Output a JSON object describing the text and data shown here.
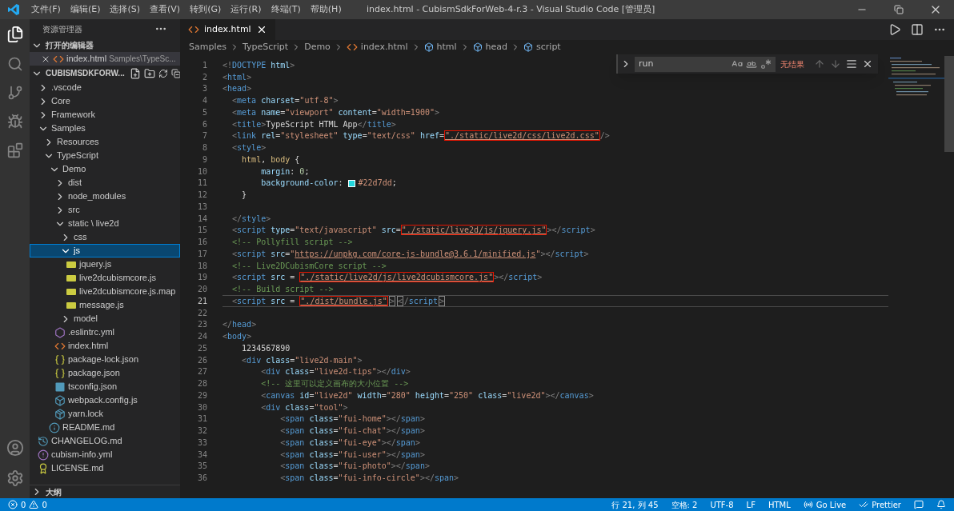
{
  "window": {
    "title": "index.html - CubismSdkForWeb-4-r.3 - Visual Studio Code [管理员]"
  },
  "menu": [
    "文件(F)",
    "编辑(E)",
    "选择(S)",
    "查看(V)",
    "转到(G)",
    "运行(R)",
    "终端(T)",
    "帮助(H)"
  ],
  "sidebar": {
    "title": "资源管理器",
    "open_editors": {
      "title": "打开的编辑器",
      "expanded": true,
      "items": [
        {
          "name": "index.html",
          "path": "Samples\\TypeSc...",
          "kind": "html"
        }
      ]
    },
    "workspace": {
      "title": "CUBISMSDKFORW...",
      "expanded": true,
      "items": [
        {
          "name": ".vscode",
          "kind": "folder",
          "expanded": false,
          "selected": false
        },
        {
          "name": "Core",
          "kind": "folder",
          "expanded": false,
          "selected": false
        },
        {
          "name": "Framework",
          "kind": "folder",
          "expanded": false,
          "selected": false
        },
        {
          "name": "Samples",
          "kind": "folder",
          "expanded": true,
          "selected": false,
          "children": [
            {
              "name": "Resources",
              "kind": "folder",
              "expanded": false,
              "selected": false
            },
            {
              "name": "TypeScript",
              "kind": "folder",
              "expanded": true,
              "selected": false,
              "children": [
                {
                  "name": "Demo",
                  "kind": "folder",
                  "expanded": true,
                  "selected": false,
                  "children": [
                    {
                      "name": "dist",
                      "kind": "folder",
                      "expanded": false,
                      "selected": false
                    },
                    {
                      "name": "node_modules",
                      "kind": "folder",
                      "expanded": false,
                      "selected": false
                    },
                    {
                      "name": "src",
                      "kind": "folder",
                      "expanded": false,
                      "selected": false
                    },
                    {
                      "name": "static \\ live2d",
                      "kind": "folder",
                      "expanded": true,
                      "selected": false,
                      "children": [
                        {
                          "name": "css",
                          "kind": "folder",
                          "expanded": false,
                          "selected": false
                        },
                        {
                          "name": "js",
                          "kind": "folder",
                          "expanded": true,
                          "selected": true,
                          "children": [
                            {
                              "name": "jquery.js",
                              "kind": "js",
                              "selected": false
                            },
                            {
                              "name": "live2dcubismcore.js",
                              "kind": "js",
                              "selected": false
                            },
                            {
                              "name": "live2dcubismcore.js.map",
                              "kind": "js",
                              "selected": false
                            },
                            {
                              "name": "message.js",
                              "kind": "js",
                              "selected": false
                            }
                          ]
                        },
                        {
                          "name": "model",
                          "kind": "folder",
                          "expanded": false,
                          "selected": false
                        }
                      ]
                    },
                    {
                      "name": ".eslintrc.yml",
                      "kind": "eslint",
                      "selected": false
                    },
                    {
                      "name": "index.html",
                      "kind": "html",
                      "selected": false
                    },
                    {
                      "name": "package-lock.json",
                      "kind": "json",
                      "selected": false
                    },
                    {
                      "name": "package.json",
                      "kind": "json",
                      "selected": false
                    },
                    {
                      "name": "tsconfig.json",
                      "kind": "ts",
                      "selected": false
                    },
                    {
                      "name": "webpack.config.js",
                      "kind": "webpack",
                      "selected": false
                    },
                    {
                      "name": "yarn.lock",
                      "kind": "yarn",
                      "selected": false
                    }
                  ]
                },
                {
                  "name": "README.md",
                  "kind": "info",
                  "selected": false
                }
              ]
            }
          ]
        },
        {
          "name": "CHANGELOG.md",
          "kind": "changelog",
          "selected": false
        },
        {
          "name": "cubism-info.yml",
          "kind": "yml",
          "selected": false
        },
        {
          "name": "LICENSE.md",
          "kind": "license",
          "selected": false
        }
      ]
    },
    "outline": {
      "title": "大纲",
      "expanded": false
    }
  },
  "tabs": [
    {
      "label": "index.html",
      "selected": true
    }
  ],
  "breadcrumbs": [
    {
      "label": "Samples",
      "kind": "folder"
    },
    {
      "label": "TypeScript",
      "kind": "folder"
    },
    {
      "label": "Demo",
      "kind": "folder"
    },
    {
      "label": "index.html",
      "kind": "html"
    },
    {
      "label": "html",
      "kind": "element"
    },
    {
      "label": "head",
      "kind": "element"
    },
    {
      "label": "script",
      "kind": "element"
    }
  ],
  "find": {
    "value": "run",
    "result": "无结果"
  },
  "code": [
    {
      "number": "1",
      "current": false,
      "tokens": [
        {
          "kind": "punct",
          "text": "<!"
        },
        {
          "kind": "tag",
          "text": "DOCTYPE"
        },
        {
          "kind": "attr",
          "text": " html"
        },
        {
          "kind": "punct",
          "text": ">"
        }
      ]
    },
    {
      "number": "2",
      "current": false,
      "tokens": [
        {
          "kind": "punct",
          "text": "<"
        },
        {
          "kind": "tag",
          "text": "html"
        },
        {
          "kind": "punct",
          "text": ">"
        }
      ]
    },
    {
      "number": "3",
      "current": false,
      "tokens": [
        {
          "kind": "punct",
          "text": "<"
        },
        {
          "kind": "tag",
          "text": "head"
        },
        {
          "kind": "punct",
          "text": ">"
        }
      ]
    },
    {
      "number": "4",
      "current": false,
      "tokens": [
        {
          "kind": "punct",
          "text": "  <"
        },
        {
          "kind": "tag",
          "text": "meta"
        },
        {
          "kind": "attr",
          "text": " charset"
        },
        {
          "kind": "text",
          "text": "="
        },
        {
          "kind": "str",
          "text": "\"utf-8\""
        },
        {
          "kind": "punct",
          "text": ">"
        }
      ]
    },
    {
      "number": "5",
      "current": false,
      "tokens": [
        {
          "kind": "punct",
          "text": "  <"
        },
        {
          "kind": "tag",
          "text": "meta"
        },
        {
          "kind": "attr",
          "text": " name"
        },
        {
          "kind": "text",
          "text": "="
        },
        {
          "kind": "str",
          "text": "\"viewport\""
        },
        {
          "kind": "attr",
          "text": " content"
        },
        {
          "kind": "text",
          "text": "="
        },
        {
          "kind": "str",
          "text": "\"width=1900\""
        },
        {
          "kind": "punct",
          "text": ">"
        }
      ]
    },
    {
      "number": "6",
      "current": false,
      "tokens": [
        {
          "kind": "punct",
          "text": "  <"
        },
        {
          "kind": "tag",
          "text": "title"
        },
        {
          "kind": "punct",
          "text": ">"
        },
        {
          "kind": "text",
          "text": "TypeScript HTML App"
        },
        {
          "kind": "punct",
          "text": "</"
        },
        {
          "kind": "tag",
          "text": "title"
        },
        {
          "kind": "punct",
          "text": ">"
        }
      ]
    },
    {
      "number": "7",
      "current": false,
      "tokens": [
        {
          "kind": "punct",
          "text": "  <"
        },
        {
          "kind": "tag",
          "text": "link"
        },
        {
          "kind": "attr",
          "text": " rel"
        },
        {
          "kind": "text",
          "text": "="
        },
        {
          "kind": "str",
          "text": "\"stylesheet\""
        },
        {
          "kind": "attr",
          "text": " type"
        },
        {
          "kind": "text",
          "text": "="
        },
        {
          "kind": "str",
          "text": "\"text/css\""
        },
        {
          "kind": "attr",
          "text": " href"
        },
        {
          "kind": "text",
          "text": "="
        },
        {
          "kind": "boxed",
          "text": "\"./static/live2d/css/live2d.css\""
        },
        {
          "kind": "punct",
          "text": "/>"
        }
      ]
    },
    {
      "number": "8",
      "current": false,
      "tokens": [
        {
          "kind": "punct",
          "text": "  <"
        },
        {
          "kind": "tag",
          "text": "style"
        },
        {
          "kind": "punct",
          "text": ">"
        }
      ]
    },
    {
      "number": "9",
      "current": false,
      "tokens": [
        {
          "kind": "selector",
          "text": "    html"
        },
        {
          "kind": "text",
          "text": ", "
        },
        {
          "kind": "selector",
          "text": "body"
        },
        {
          "kind": "text",
          "text": " {"
        }
      ]
    },
    {
      "number": "10",
      "current": false,
      "tokens": [
        {
          "kind": "prop",
          "text": "        margin"
        },
        {
          "kind": "text",
          "text": ": "
        },
        {
          "kind": "num",
          "text": "0"
        },
        {
          "kind": "text",
          "text": ";"
        }
      ]
    },
    {
      "number": "11",
      "current": false,
      "tokens": [
        {
          "kind": "prop",
          "text": "        background-color"
        },
        {
          "kind": "text",
          "text": ": "
        },
        {
          "kind": "swatch",
          "color": "#22d7dd"
        },
        {
          "kind": "str",
          "text": "#22d7dd"
        },
        {
          "kind": "text",
          "text": ";"
        }
      ]
    },
    {
      "number": "12",
      "current": false,
      "tokens": [
        {
          "kind": "text",
          "text": "    }"
        }
      ]
    },
    {
      "number": "13",
      "current": false
    },
    {
      "number": "14",
      "current": false,
      "tokens": [
        {
          "kind": "punct",
          "text": "  </"
        },
        {
          "kind": "tag",
          "text": "style"
        },
        {
          "kind": "punct",
          "text": ">"
        }
      ]
    },
    {
      "number": "15",
      "current": false,
      "tokens": [
        {
          "kind": "punct",
          "text": "  <"
        },
        {
          "kind": "tag",
          "text": "script"
        },
        {
          "kind": "attr",
          "text": " type"
        },
        {
          "kind": "text",
          "text": "="
        },
        {
          "kind": "str",
          "text": "\"text/javascript\""
        },
        {
          "kind": "attr",
          "text": " src"
        },
        {
          "kind": "text",
          "text": "="
        },
        {
          "kind": "boxed",
          "text": "\"./static/live2d/js/jquery.js\""
        },
        {
          "kind": "punct",
          "text": "></"
        },
        {
          "kind": "tag",
          "text": "script"
        },
        {
          "kind": "punct",
          "text": ">"
        }
      ]
    },
    {
      "number": "16",
      "current": false,
      "tokens": [
        {
          "kind": "comment",
          "text": "  <!-- Pollyfill script -->"
        }
      ]
    },
    {
      "number": "17",
      "current": false,
      "tokens": [
        {
          "kind": "punct",
          "text": "  <"
        },
        {
          "kind": "tag",
          "text": "script"
        },
        {
          "kind": "attr",
          "text": " src"
        },
        {
          "kind": "text",
          "text": "="
        },
        {
          "kind": "str",
          "text": "\""
        },
        {
          "kind": "link",
          "text": "https://unpkg.com/core-js-bundle@3.6.1/minified.js"
        },
        {
          "kind": "str",
          "text": "\""
        },
        {
          "kind": "punct",
          "text": "></"
        },
        {
          "kind": "tag",
          "text": "script"
        },
        {
          "kind": "punct",
          "text": ">"
        }
      ]
    },
    {
      "number": "18",
      "current": false,
      "tokens": [
        {
          "kind": "comment",
          "text": "  <!-- Live2DCubismCore script -->"
        }
      ]
    },
    {
      "number": "19",
      "current": false,
      "tokens": [
        {
          "kind": "punct",
          "text": "  <"
        },
        {
          "kind": "tag",
          "text": "script"
        },
        {
          "kind": "attr",
          "text": " src"
        },
        {
          "kind": "text",
          "text": " = "
        },
        {
          "kind": "boxed",
          "text": "\"./static/live2d/js/live2dcubismcore.js\""
        },
        {
          "kind": "punct",
          "text": "></"
        },
        {
          "kind": "tag",
          "text": "script"
        },
        {
          "kind": "punct",
          "text": ">"
        }
      ]
    },
    {
      "number": "20",
      "current": false,
      "tokens": [
        {
          "kind": "comment",
          "text": "  <!-- Build script -->"
        }
      ]
    },
    {
      "number": "21",
      "current": true,
      "tokens": [
        {
          "kind": "punct",
          "text": "  <"
        },
        {
          "kind": "tag",
          "text": "script"
        },
        {
          "kind": "attr",
          "text": " src"
        },
        {
          "kind": "text",
          "text": " = "
        },
        {
          "kind": "boxed",
          "text": "\"./dist/bundle.js\""
        },
        {
          "kind": "match",
          "text": ">"
        },
        {
          "kind": "match",
          "text": "<"
        },
        {
          "kind": "punct",
          "text": "/"
        },
        {
          "kind": "tag",
          "text": "script"
        },
        {
          "kind": "match",
          "text": ">"
        }
      ]
    },
    {
      "number": "22",
      "current": false
    },
    {
      "number": "23",
      "current": false,
      "tokens": [
        {
          "kind": "punct",
          "text": "</"
        },
        {
          "kind": "tag",
          "text": "head"
        },
        {
          "kind": "punct",
          "text": ">"
        }
      ]
    },
    {
      "number": "24",
      "current": false,
      "tokens": [
        {
          "kind": "punct",
          "text": "<"
        },
        {
          "kind": "tag",
          "text": "body"
        },
        {
          "kind": "punct",
          "text": ">"
        }
      ]
    },
    {
      "number": "25",
      "current": false,
      "tokens": [
        {
          "kind": "text",
          "text": "    1234567890"
        }
      ]
    },
    {
      "number": "26",
      "current": false,
      "tokens": [
        {
          "kind": "punct",
          "text": "    <"
        },
        {
          "kind": "tag",
          "text": "div"
        },
        {
          "kind": "attr",
          "text": " class"
        },
        {
          "kind": "text",
          "text": "="
        },
        {
          "kind": "str",
          "text": "\"live2d-main\""
        },
        {
          "kind": "punct",
          "text": ">"
        }
      ]
    },
    {
      "number": "27",
      "current": false,
      "tokens": [
        {
          "kind": "punct",
          "text": "        <"
        },
        {
          "kind": "tag",
          "text": "div"
        },
        {
          "kind": "attr",
          "text": " class"
        },
        {
          "kind": "text",
          "text": "="
        },
        {
          "kind": "str",
          "text": "\"live2d-tips\""
        },
        {
          "kind": "punct",
          "text": "></"
        },
        {
          "kind": "tag",
          "text": "div"
        },
        {
          "kind": "punct",
          "text": ">"
        }
      ]
    },
    {
      "number": "28",
      "current": false,
      "tokens": [
        {
          "kind": "comment",
          "text": "        <!-- 这里可以定义画布的大小位置 -->"
        }
      ]
    },
    {
      "number": "29",
      "current": false,
      "tokens": [
        {
          "kind": "punct",
          "text": "        <"
        },
        {
          "kind": "tag",
          "text": "canvas"
        },
        {
          "kind": "attr",
          "text": " id"
        },
        {
          "kind": "text",
          "text": "="
        },
        {
          "kind": "str",
          "text": "\"live2d\""
        },
        {
          "kind": "attr",
          "text": " width"
        },
        {
          "kind": "text",
          "text": "="
        },
        {
          "kind": "str",
          "text": "\"280\""
        },
        {
          "kind": "attr",
          "text": " height"
        },
        {
          "kind": "text",
          "text": "="
        },
        {
          "kind": "str",
          "text": "\"250\""
        },
        {
          "kind": "attr",
          "text": " class"
        },
        {
          "kind": "text",
          "text": "="
        },
        {
          "kind": "str",
          "text": "\"live2d\""
        },
        {
          "kind": "punct",
          "text": "></"
        },
        {
          "kind": "tag",
          "text": "canvas"
        },
        {
          "kind": "punct",
          "text": ">"
        }
      ]
    },
    {
      "number": "30",
      "current": false,
      "tokens": [
        {
          "kind": "punct",
          "text": "        <"
        },
        {
          "kind": "tag",
          "text": "div"
        },
        {
          "kind": "attr",
          "text": " class"
        },
        {
          "kind": "text",
          "text": "="
        },
        {
          "kind": "str",
          "text": "\"tool\""
        },
        {
          "kind": "punct",
          "text": ">"
        }
      ]
    },
    {
      "number": "31",
      "current": false,
      "tokens": [
        {
          "kind": "punct",
          "text": "            <"
        },
        {
          "kind": "tag",
          "text": "span"
        },
        {
          "kind": "attr",
          "text": " class"
        },
        {
          "kind": "text",
          "text": "="
        },
        {
          "kind": "str",
          "text": "\"fui-home\""
        },
        {
          "kind": "punct",
          "text": "></"
        },
        {
          "kind": "tag",
          "text": "span"
        },
        {
          "kind": "punct",
          "text": ">"
        }
      ]
    },
    {
      "number": "32",
      "current": false,
      "tokens": [
        {
          "kind": "punct",
          "text": "            <"
        },
        {
          "kind": "tag",
          "text": "span"
        },
        {
          "kind": "attr",
          "text": " class"
        },
        {
          "kind": "text",
          "text": "="
        },
        {
          "kind": "str",
          "text": "\"fui-chat\""
        },
        {
          "kind": "punct",
          "text": "></"
        },
        {
          "kind": "tag",
          "text": "span"
        },
        {
          "kind": "punct",
          "text": ">"
        }
      ]
    },
    {
      "number": "33",
      "current": false,
      "tokens": [
        {
          "kind": "punct",
          "text": "            <"
        },
        {
          "kind": "tag",
          "text": "span"
        },
        {
          "kind": "attr",
          "text": " class"
        },
        {
          "kind": "text",
          "text": "="
        },
        {
          "kind": "str",
          "text": "\"fui-eye\""
        },
        {
          "kind": "punct",
          "text": "></"
        },
        {
          "kind": "tag",
          "text": "span"
        },
        {
          "kind": "punct",
          "text": ">"
        }
      ]
    },
    {
      "number": "34",
      "current": false,
      "tokens": [
        {
          "kind": "punct",
          "text": "            <"
        },
        {
          "kind": "tag",
          "text": "span"
        },
        {
          "kind": "attr",
          "text": " class"
        },
        {
          "kind": "text",
          "text": "="
        },
        {
          "kind": "str",
          "text": "\"fui-user\""
        },
        {
          "kind": "punct",
          "text": "></"
        },
        {
          "kind": "tag",
          "text": "span"
        },
        {
          "kind": "punct",
          "text": ">"
        }
      ]
    },
    {
      "number": "35",
      "current": false,
      "tokens": [
        {
          "kind": "punct",
          "text": "            <"
        },
        {
          "kind": "tag",
          "text": "span"
        },
        {
          "kind": "attr",
          "text": " class"
        },
        {
          "kind": "text",
          "text": "="
        },
        {
          "kind": "str",
          "text": "\"fui-photo\""
        },
        {
          "kind": "punct",
          "text": "></"
        },
        {
          "kind": "tag",
          "text": "span"
        },
        {
          "kind": "punct",
          "text": ">"
        }
      ]
    },
    {
      "number": "36",
      "current": false,
      "tokens": [
        {
          "kind": "punct",
          "text": "            <"
        },
        {
          "kind": "tag",
          "text": "span"
        },
        {
          "kind": "attr",
          "text": " class"
        },
        {
          "kind": "text",
          "text": "="
        },
        {
          "kind": "str",
          "text": "\"fui-info-circle\""
        },
        {
          "kind": "punct",
          "text": "></"
        },
        {
          "kind": "tag",
          "text": "span"
        },
        {
          "kind": "punct",
          "text": ">"
        }
      ]
    }
  ],
  "status_bar": {
    "errors": "0",
    "warnings": "0",
    "items": [
      {
        "text": "行 21, 列 45",
        "kind": "text"
      },
      {
        "text": "空格: 2",
        "kind": "text"
      },
      {
        "text": "UTF-8",
        "kind": "text"
      },
      {
        "text": "LF",
        "kind": "text"
      },
      {
        "text": "HTML",
        "kind": "text"
      },
      {
        "text": "Go Live",
        "kind": "live"
      },
      {
        "text": "Prettier",
        "kind": "prettier"
      }
    ]
  }
}
